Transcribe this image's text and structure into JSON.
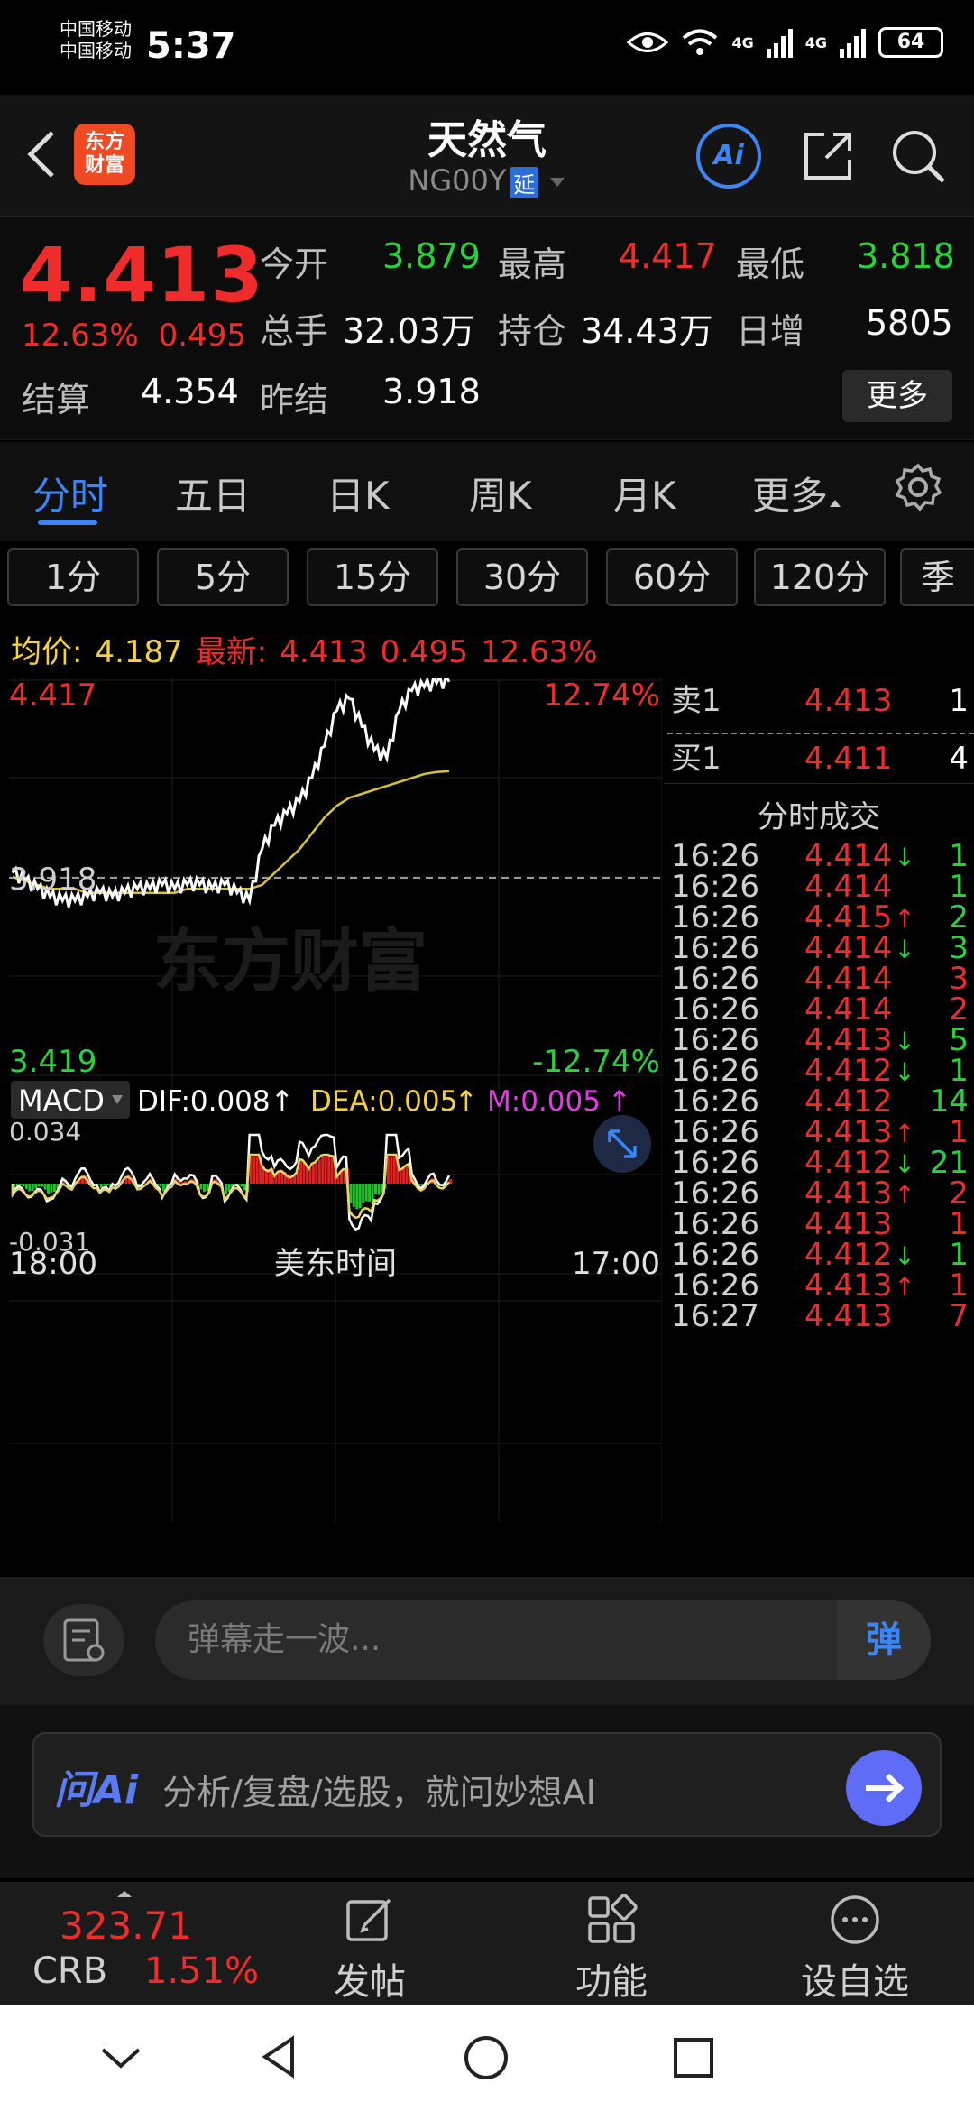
{
  "status": {
    "carrier_1": "中国移动",
    "carrier_2": "中国移动",
    "time": "5:37",
    "net_1": "4G",
    "net_2": "4G",
    "battery": "64"
  },
  "header": {
    "logo_line1": "东方",
    "logo_line2": "财富",
    "title": "天然气",
    "code": "NG00Y",
    "delay_badge": "延",
    "ai_label": "Ai"
  },
  "quote": {
    "last": "4.413",
    "change_pct": "12.63%",
    "change": "0.495",
    "open_label": "今开",
    "open": "3.879",
    "high_label": "最高",
    "high": "4.417",
    "low_label": "最低",
    "low": "3.818",
    "volume_label": "总手",
    "volume": "32.03万",
    "oi_label": "持仓",
    "oi": "34.43万",
    "oi_change_label": "日增",
    "oi_change": "5805",
    "settle_label": "结算",
    "settle": "4.354",
    "prev_settle_label": "昨结",
    "prev_settle": "3.918",
    "more_button": "更多"
  },
  "tabs": {
    "fenshi": "分时",
    "wuri": "五日",
    "rik": "日K",
    "zhouk": "周K",
    "yuek": "月K",
    "more": "更多"
  },
  "intervals": [
    "1分",
    "5分",
    "15分",
    "30分",
    "60分",
    "120分",
    "季"
  ],
  "avg_row": {
    "avg_label": "均价:",
    "avg": "4.187",
    "last_label": "最新:",
    "last": "4.413",
    "chg": "0.495",
    "pct": "12.63%"
  },
  "chart": {
    "top_price": "4.417",
    "top_pct": "12.74%",
    "mid_price": "3.918",
    "bottom_price": "3.419",
    "bottom_pct": "-12.74%",
    "watermark": "东方财富",
    "macd_label": "MACD",
    "dif": "DIF:0.008",
    "dea": "DEA:0.005",
    "m": "M:0.005",
    "macd_top": "0.034",
    "macd_bottom": "-0.031",
    "time_start": "18:00",
    "time_mid": "美东时间",
    "time_end": "17:00"
  },
  "chart_data": {
    "type": "line",
    "title": "",
    "ylim": [
      3.419,
      4.417
    ],
    "prev_settle": 3.918,
    "series": [
      {
        "name": "最新",
        "values": [
          3.93,
          3.91,
          3.89,
          3.87,
          3.86,
          3.86,
          3.87,
          3.88,
          3.87,
          3.88,
          3.89,
          3.89,
          3.9,
          3.89,
          3.9,
          3.9,
          3.89,
          3.9,
          3.88,
          3.86,
          3.99,
          4.05,
          4.08,
          4.11,
          4.17,
          4.25,
          4.34,
          4.37,
          4.3,
          4.24,
          4.22,
          4.34,
          4.39,
          4.4,
          4.41,
          4.413
        ]
      },
      {
        "name": "均价",
        "values": [
          3.92,
          3.91,
          3.9,
          3.89,
          3.89,
          3.89,
          3.88,
          3.88,
          3.88,
          3.88,
          3.88,
          3.88,
          3.88,
          3.88,
          3.89,
          3.89,
          3.89,
          3.89,
          3.89,
          3.89,
          3.9,
          3.93,
          3.96,
          3.99,
          4.03,
          4.07,
          4.1,
          4.12,
          4.13,
          4.14,
          4.15,
          4.16,
          4.17,
          4.18,
          4.185,
          4.187
        ]
      }
    ]
  },
  "orderbook": {
    "ask_label": "卖1",
    "ask_price": "4.413",
    "ask_vol": "1",
    "bid_label": "买1",
    "bid_price": "4.411",
    "bid_vol": "4",
    "trades_title": "分时成交",
    "trades": [
      {
        "t": "16:26",
        "p": "4.414",
        "d": "↓",
        "v": "1",
        "vc": "green"
      },
      {
        "t": "16:26",
        "p": "4.414",
        "d": "",
        "v": "1",
        "vc": "green"
      },
      {
        "t": "16:26",
        "p": "4.415",
        "d": "↑",
        "v": "2",
        "vc": "green"
      },
      {
        "t": "16:26",
        "p": "4.414",
        "d": "↓",
        "v": "3",
        "vc": "green"
      },
      {
        "t": "16:26",
        "p": "4.414",
        "d": "",
        "v": "3",
        "vc": "red"
      },
      {
        "t": "16:26",
        "p": "4.414",
        "d": "",
        "v": "2",
        "vc": "red"
      },
      {
        "t": "16:26",
        "p": "4.413",
        "d": "↓",
        "v": "5",
        "vc": "green"
      },
      {
        "t": "16:26",
        "p": "4.412",
        "d": "↓",
        "v": "1",
        "vc": "green"
      },
      {
        "t": "16:26",
        "p": "4.412",
        "d": "",
        "v": "14",
        "vc": "green"
      },
      {
        "t": "16:26",
        "p": "4.413",
        "d": "↑",
        "v": "1",
        "vc": "red"
      },
      {
        "t": "16:26",
        "p": "4.412",
        "d": "↓",
        "v": "21",
        "vc": "green"
      },
      {
        "t": "16:26",
        "p": "4.413",
        "d": "↑",
        "v": "2",
        "vc": "red"
      },
      {
        "t": "16:26",
        "p": "4.413",
        "d": "",
        "v": "1",
        "vc": "red"
      },
      {
        "t": "16:26",
        "p": "4.412",
        "d": "↓",
        "v": "1",
        "vc": "green"
      },
      {
        "t": "16:26",
        "p": "4.413",
        "d": "↑",
        "v": "1",
        "vc": "red"
      },
      {
        "t": "16:27",
        "p": "4.413",
        "d": "",
        "v": "7",
        "vc": "red"
      }
    ]
  },
  "comment": {
    "placeholder": "弹幕走一波...",
    "toggle": "弹"
  },
  "ask": {
    "logo": "问Ai",
    "text": "分析/复盘/选股，就问妙想AI"
  },
  "bottom": {
    "crb_price": "323.71",
    "crb_name": "CRB",
    "crb_pct": "1.51%",
    "post": "发帖",
    "functions": "功能",
    "watchlist": "设自选"
  }
}
